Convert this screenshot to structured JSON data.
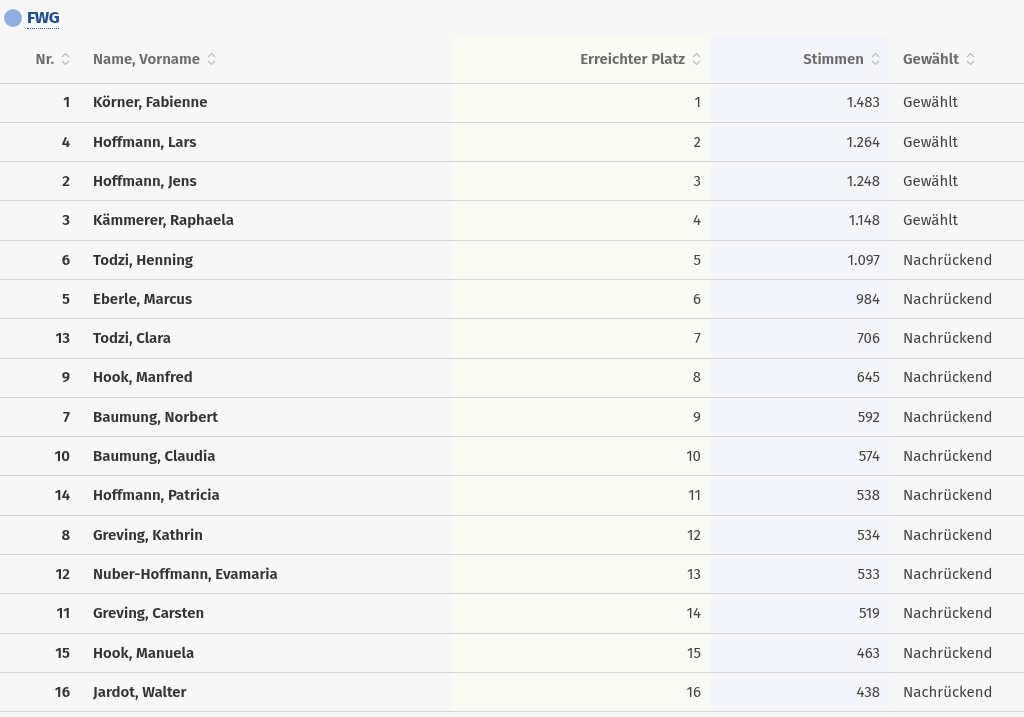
{
  "party": {
    "name": "FWG",
    "color": "#8fb0de"
  },
  "table": {
    "columns": [
      "Nr.",
      "Name, Vorname",
      "Erreichter Platz",
      "Stimmen",
      "Gewählt"
    ],
    "rows": [
      [
        "1",
        "Körner, Fabienne",
        "1",
        "1.483",
        "Gewählt"
      ],
      [
        "4",
        "Hoffmann, Lars",
        "2",
        "1.264",
        "Gewählt"
      ],
      [
        "2",
        "Hoffmann, Jens",
        "3",
        "1.248",
        "Gewählt"
      ],
      [
        "3",
        "Kämmerer, Raphaela",
        "4",
        "1.148",
        "Gewählt"
      ],
      [
        "6",
        "Todzi, Henning",
        "5",
        "1.097",
        "Nachrückend"
      ],
      [
        "5",
        "Eberle, Marcus",
        "6",
        "984",
        "Nachrückend"
      ],
      [
        "13",
        "Todzi, Clara",
        "7",
        "706",
        "Nachrückend"
      ],
      [
        "9",
        "Hook, Manfred",
        "8",
        "645",
        "Nachrückend"
      ],
      [
        "7",
        "Baumung, Norbert",
        "9",
        "592",
        "Nachrückend"
      ],
      [
        "10",
        "Baumung, Claudia",
        "10",
        "574",
        "Nachrückend"
      ],
      [
        "14",
        "Hoffmann, Patricia",
        "11",
        "538",
        "Nachrückend"
      ],
      [
        "8",
        "Greving, Kathrin",
        "12",
        "534",
        "Nachrückend"
      ],
      [
        "12",
        "Nuber-Hoffmann, Evamaria",
        "13",
        "533",
        "Nachrückend"
      ],
      [
        "11",
        "Greving, Carsten",
        "14",
        "519",
        "Nachrückend"
      ],
      [
        "15",
        "Hook, Manuela",
        "15",
        "463",
        "Nachrückend"
      ],
      [
        "16",
        "Jardot, Walter",
        "16",
        "438",
        "Nachrückend"
      ]
    ]
  }
}
